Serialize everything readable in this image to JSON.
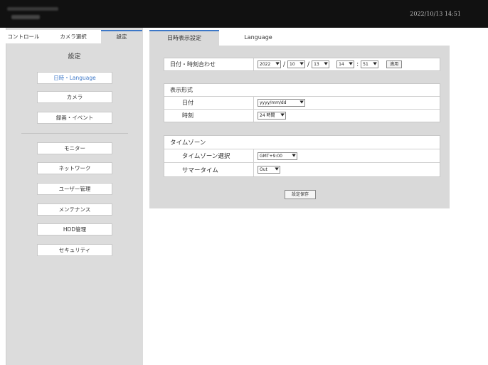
{
  "header": {
    "datetime": "2022/10/13 14:51"
  },
  "sidebar": {
    "tabs": [
      {
        "label": "コントロール"
      },
      {
        "label": "カメラ選択"
      },
      {
        "label": "設定"
      }
    ],
    "title": "設定",
    "items": [
      {
        "label": "日時・Language"
      },
      {
        "label": "カメラ"
      },
      {
        "label": "録画・イベント"
      },
      {
        "label": "モニター"
      },
      {
        "label": "ネットワーク"
      },
      {
        "label": "ユーザー管理"
      },
      {
        "label": "メンテナンス"
      },
      {
        "label": "HDD管理"
      },
      {
        "label": "セキュリティ"
      }
    ]
  },
  "main": {
    "tabs": [
      {
        "label": "日時表示設定"
      },
      {
        "label": "Language"
      }
    ],
    "datetime_group": {
      "label": "日付・時刻合わせ",
      "year": "2022",
      "month": "10",
      "day": "13",
      "hour": "14",
      "minute": "51",
      "date_sep": "/",
      "time_sep": ":",
      "apply_label": "適用"
    },
    "format_group": {
      "header": "表示形式",
      "date_label": "日付",
      "date_value": "yyyy/mm/dd",
      "time_label": "時刻",
      "time_value": "24 時間"
    },
    "timezone_group": {
      "header": "タイムゾーン",
      "tz_label": "タイムゾーン選択",
      "tz_value": "GMT+9:00",
      "dst_label": "サマータイム",
      "dst_value": "Out"
    },
    "save_label": "設定保存"
  },
  "colors": {
    "accent": "#3c77c7",
    "topbar": "#111111",
    "sidebar_bg": "#dcdcdc",
    "panel_bg": "#d9d9d9"
  },
  "icons": {
    "select_arrow": "chevron-down-icon"
  }
}
